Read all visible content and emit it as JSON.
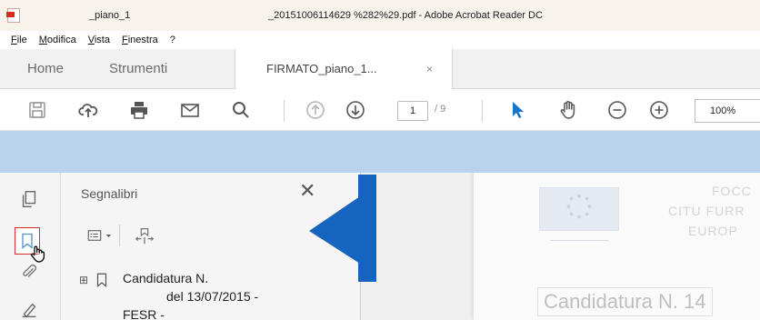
{
  "window": {
    "title_part1": "_piano_1",
    "title_part2": "_20151006114629 %282%29.pdf - Adobe Acrobat Reader DC"
  },
  "menu": {
    "items": [
      "File",
      "Modifica",
      "Vista",
      "Finestra",
      "?"
    ]
  },
  "tabs": {
    "home": "Home",
    "tools": "Strumenti",
    "document": "FIRMATO_piano_1...",
    "close_glyph": "×"
  },
  "toolbar": {
    "page_current": "1",
    "page_total": "/ 9",
    "zoom": "100%"
  },
  "bookmarks_panel": {
    "title": "Segnalibri",
    "close_glyph": "✕",
    "items": [
      {
        "expand_glyph": "⊞",
        "line1": "Candidatura N.",
        "line2": "del 13/07/2015 -",
        "line3": "FESR -"
      }
    ]
  },
  "document": {
    "header_lines": [
      "FOCC",
      "CITU FURR",
      "EUROP"
    ],
    "candidatura": "Candidatura N. 14"
  },
  "colors": {
    "blue_band": "#b9d3ec",
    "arrow": "#1565c0",
    "active_outline": "#d32f2f",
    "cursor_blue": "#1a73c9"
  },
  "icons": {
    "toolbar": [
      "save-icon",
      "cloud-upload-icon",
      "print-icon",
      "email-icon",
      "search-icon",
      "page-up-icon",
      "page-down-icon",
      "select-arrow-icon",
      "hand-tool-icon",
      "zoom-out-icon",
      "zoom-in-icon"
    ],
    "rail": [
      "pages-icon",
      "bookmark-icon",
      "attachment-icon",
      "signature-icon"
    ]
  }
}
